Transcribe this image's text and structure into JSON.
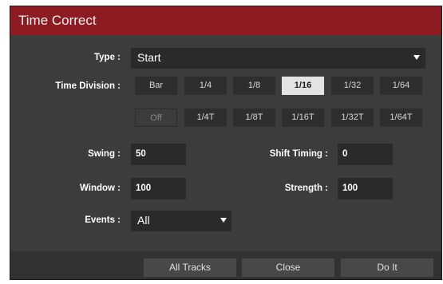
{
  "dialog": {
    "title": "Time Correct"
  },
  "type": {
    "label": "Type :",
    "value": "Start"
  },
  "time_division": {
    "label": "Time Division :",
    "row1": [
      "Bar",
      "1/4",
      "1/8",
      "1/16",
      "1/32",
      "1/64"
    ],
    "row2": [
      "Off",
      "1/4T",
      "1/8T",
      "1/16T",
      "1/32T",
      "1/64T"
    ],
    "selected": "1/16"
  },
  "swing": {
    "label": "Swing :",
    "value": "50"
  },
  "shift_timing": {
    "label": "Shift Timing :",
    "value": "0"
  },
  "window": {
    "label": "Window :",
    "value": "100"
  },
  "strength": {
    "label": "Strength :",
    "value": "100"
  },
  "events": {
    "label": "Events :",
    "value": "All"
  },
  "footer": {
    "all_tracks": "All Tracks",
    "close": "Close",
    "do_it": "Do It"
  },
  "colors": {
    "titlebar": "#8e1b22",
    "panel": "#3c3c3c",
    "active_button": "#e3e3e3"
  }
}
